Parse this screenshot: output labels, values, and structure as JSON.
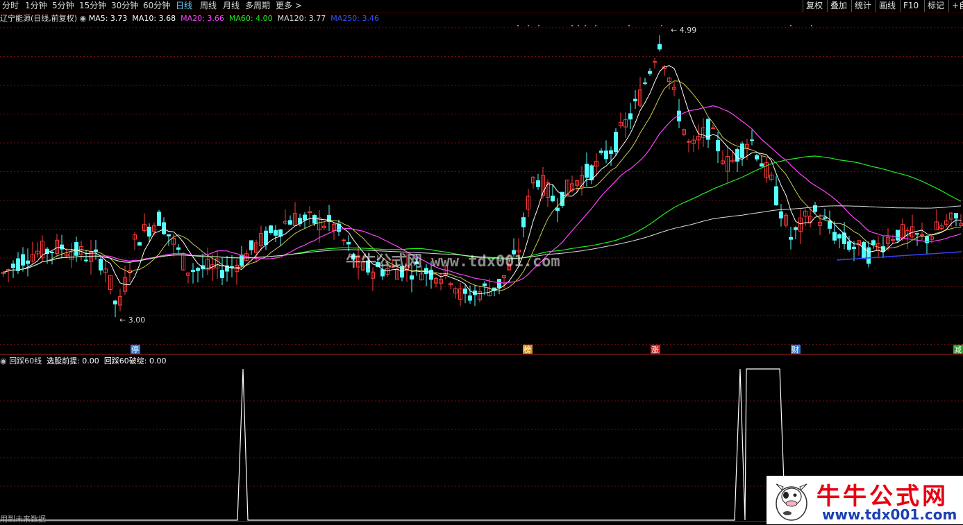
{
  "toolbar": {
    "periods": [
      "分时",
      "1分钟",
      "5分钟",
      "15分钟",
      "30分钟",
      "60分钟",
      "日线",
      "周线",
      "月线",
      "多周期",
      "更多 >"
    ],
    "active_period": "日线",
    "right_buttons": [
      "复权",
      "叠加",
      "统计",
      "画线",
      "F10",
      "标记",
      "+自"
    ]
  },
  "main_legend": {
    "stock_name": "辽宁能源(日线,前复权)",
    "ma5": "MA5: 3.73",
    "ma10": "MA10: 3.68",
    "ma20": "MA20: 3.66",
    "ma60": "MA60: 4.00",
    "ma120": "MA120: 3.77",
    "ma250": "MA250: 3.46"
  },
  "price_labels": {
    "high": "4.99",
    "low": "3.00"
  },
  "event_markers": [
    "停",
    "榜",
    "涨",
    "财",
    "减"
  ],
  "watermark": "牛牛公式网 www.tdx001.com",
  "sub_legend": {
    "name": "回踩60线",
    "line1": "选股前提: 0.00",
    "line2": "回踩60破绽: 0.00"
  },
  "footer_note": "用到未来数据",
  "logo": {
    "title": "牛牛公式网",
    "url": "www.tdx001.com"
  },
  "colors": {
    "up": "#ff3b3b",
    "down": "#54ffff",
    "ma5": "#ffffff",
    "ma10": "#ffff66",
    "ma20": "#ff44ff",
    "ma60": "#22ee22",
    "ma120": "#dddddd",
    "ma250": "#3344ff",
    "grid": "#6b1010"
  }
}
